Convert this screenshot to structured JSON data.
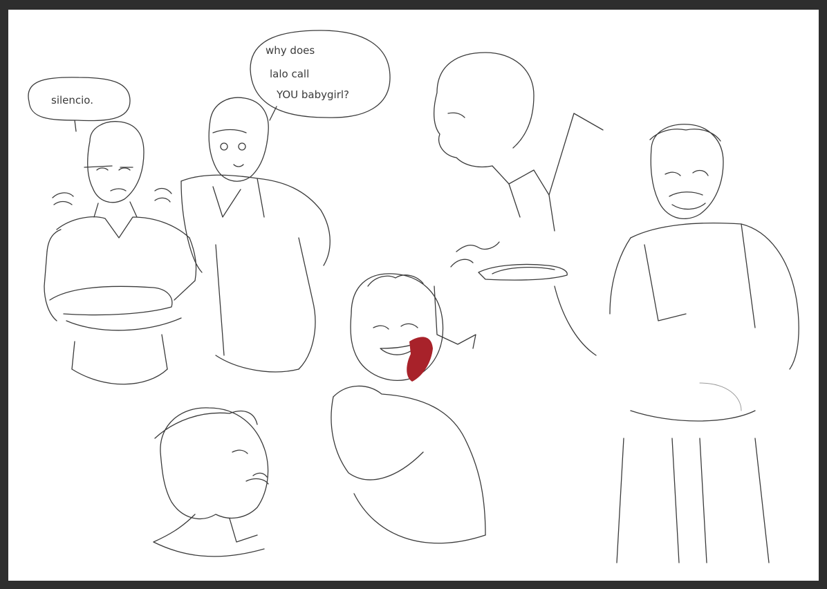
{
  "colors": {
    "background": "#2e2e2e",
    "paper": "#ffffff",
    "ink": "#3a3a3a",
    "blood": "#a8222a"
  },
  "bubbles": {
    "left": {
      "line1": "silencio."
    },
    "middle": {
      "line1": "why does",
      "line2": "lalo call",
      "line3": "YOU babygirl?"
    }
  }
}
